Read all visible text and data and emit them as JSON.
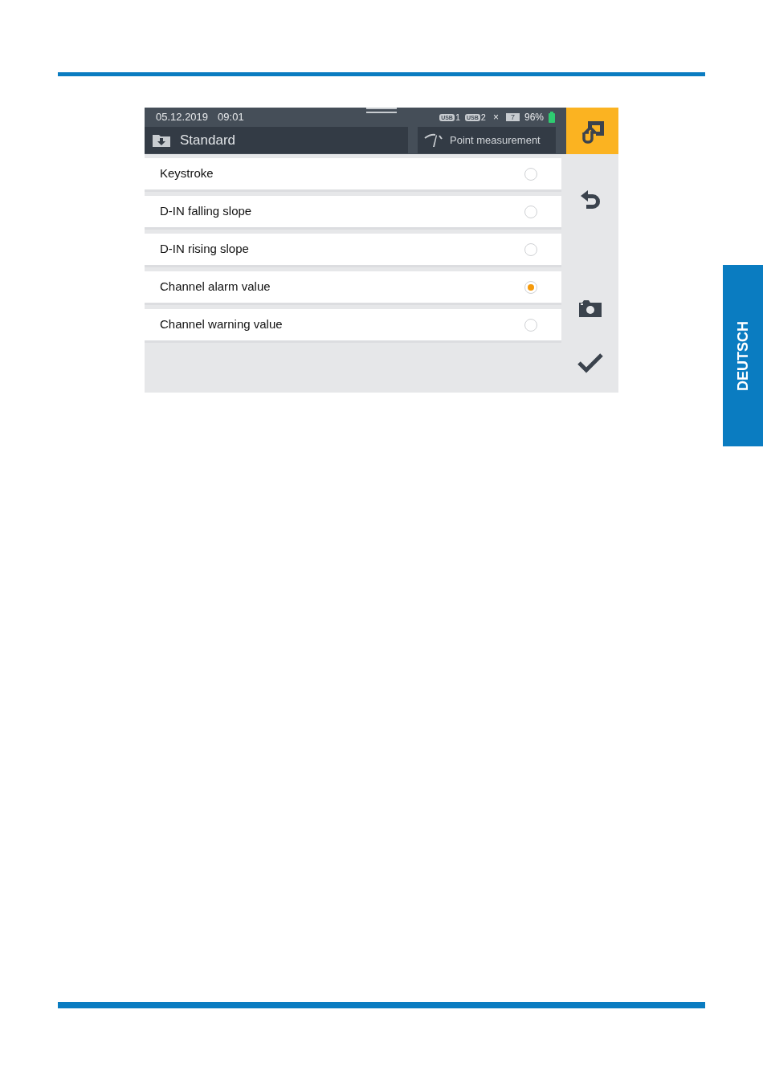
{
  "status_bar": {
    "date": "05.12.2019",
    "time": "09:01",
    "usb_ports": [
      {
        "label": "USB",
        "number": "1"
      },
      {
        "label": "USB",
        "number": "2"
      }
    ],
    "close_mark": "×",
    "battery_cell": "7",
    "battery_percent": "96%"
  },
  "header": {
    "profile": "Standard",
    "mode": "Point measurement"
  },
  "options": [
    {
      "label": "Keystroke",
      "selected": false
    },
    {
      "label": "D-IN falling slope",
      "selected": false
    },
    {
      "label": "D-IN rising slope",
      "selected": false
    },
    {
      "label": "Channel alarm value",
      "selected": true
    },
    {
      "label": "Channel warning value",
      "selected": false
    }
  ],
  "language_tab": "DEUTSCH"
}
